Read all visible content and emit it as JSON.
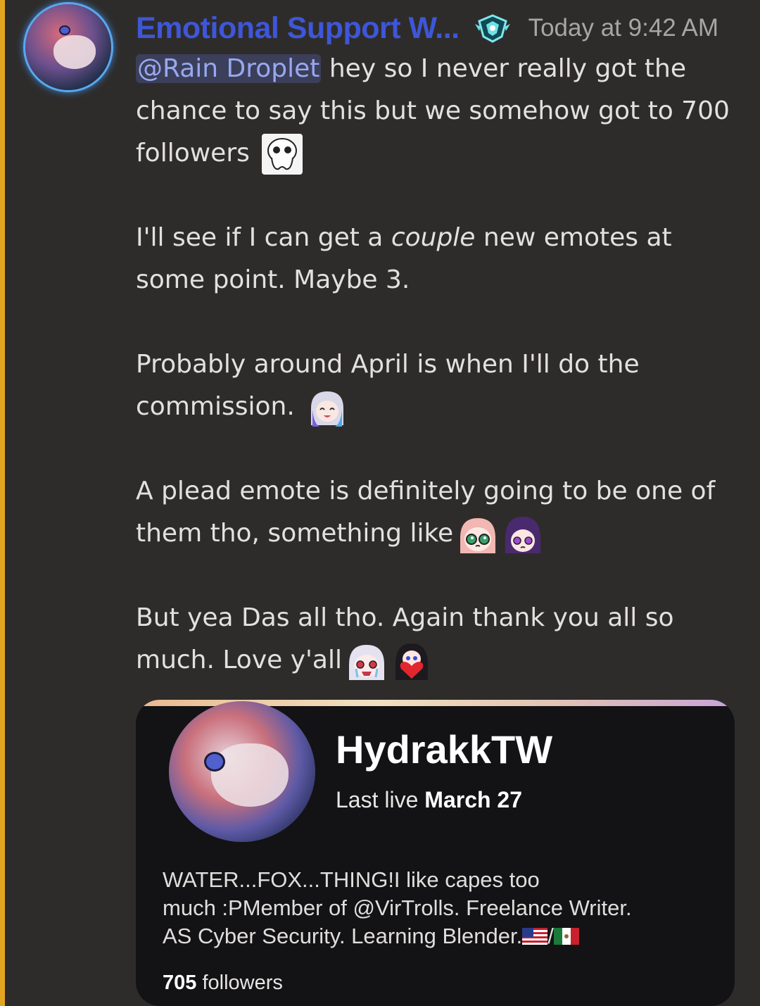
{
  "message": {
    "author": "Emotional Support W...",
    "badge_icon": "hypesquad-badge-icon",
    "timestamp": "Today at 9:42 AM",
    "mention": "@Rain Droplet",
    "para1_text": " hey so I never really got the chance to say this but we somehow got to 700 followers",
    "para2_before": "I'll see if I can get a ",
    "para2_italic": "couple",
    "para2_after": " new emotes at some point. Maybe 3.",
    "para3_text": "Probably around April is when I'll do the commission.",
    "para4_text": "A plead emote is definitely going to be one of them tho, something like",
    "para5_text": "But yea Das all tho. Again thank you all so much. Love y'all",
    "emotes": [
      "ghost-emote-icon",
      "purple-hair-girl-emote-icon",
      "pink-hair-plead-emote-icon",
      "purple-girl-plead-emote-icon",
      "white-hair-crying-emote-icon",
      "black-hair-heart-emote-icon"
    ]
  },
  "embed": {
    "channel_name": "HydrakkTW",
    "last_live_label": "Last live",
    "last_live_date": "March 27",
    "bio_line1": "WATER...FOX...THING!I like capes too",
    "bio_line2": "much :PMember of @VirTrolls. Freelance Writer.",
    "bio_line3": "AS Cyber Security. Learning Blender.",
    "bio_separator": "/",
    "flags": [
      "us-flag-icon",
      "mexico-flag-icon"
    ],
    "followers_count": "705",
    "followers_label": " followers"
  },
  "colors": {
    "background": "#2e2c2b",
    "mention_bar": "#e3a520",
    "username": "#3e56d8",
    "mention_text": "#98a8f0",
    "embed_background": "#131214"
  }
}
